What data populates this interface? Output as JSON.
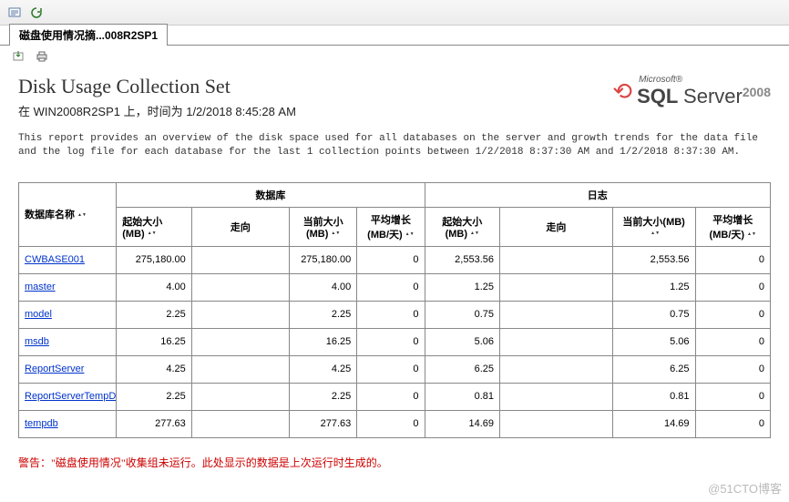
{
  "tab_label": "磁盘使用情况摘...008R2SP1",
  "report": {
    "title": "Disk Usage Collection Set",
    "subtitle": "在 WIN2008R2SP1 上，时间为 1/2/2018 8:45:28 AM",
    "description": "This report provides an overview of the disk space used for all databases on the server and growth trends for the data file and the log file for each database for the last 1 collection points between 1/2/2018 8:37:30 AM and 1/2/2018 8:37:30 AM.",
    "warning": "警告：\"磁盘使用情况\"收集组未运行。此处显示的数据是上次运行时生成的。"
  },
  "logo": {
    "ms": "Microsoft®",
    "sql": "SQL",
    "server": "Server",
    "year": "2008"
  },
  "columns": {
    "group_db": "数据库",
    "group_log": "日志",
    "name": "数据库名称",
    "start_size": "起始大小 (MB)",
    "trend": "走向",
    "current_size": "当前大小(MB)",
    "avg_growth": "平均增长 (MB/天)",
    "start_size2": "起始大小 (MB)",
    "trend2": "走向",
    "current_size2": "当前大小(MB)",
    "avg_growth2": "平均增长 (MB/天)"
  },
  "rows": [
    {
      "name": "CWBASE001",
      "d_start": "275,180.00",
      "d_cur": "275,180.00",
      "d_avg": "0",
      "l_start": "2,553.56",
      "l_cur": "2,553.56",
      "l_avg": "0"
    },
    {
      "name": "master",
      "d_start": "4.00",
      "d_cur": "4.00",
      "d_avg": "0",
      "l_start": "1.25",
      "l_cur": "1.25",
      "l_avg": "0"
    },
    {
      "name": "model",
      "d_start": "2.25",
      "d_cur": "2.25",
      "d_avg": "0",
      "l_start": "0.75",
      "l_cur": "0.75",
      "l_avg": "0"
    },
    {
      "name": "msdb",
      "d_start": "16.25",
      "d_cur": "16.25",
      "d_avg": "0",
      "l_start": "5.06",
      "l_cur": "5.06",
      "l_avg": "0"
    },
    {
      "name": "ReportServer",
      "d_start": "4.25",
      "d_cur": "4.25",
      "d_avg": "0",
      "l_start": "6.25",
      "l_cur": "6.25",
      "l_avg": "0"
    },
    {
      "name": "ReportServerTempDB",
      "d_start": "2.25",
      "d_cur": "2.25",
      "d_avg": "0",
      "l_start": "0.81",
      "l_cur": "0.81",
      "l_avg": "0"
    },
    {
      "name": "tempdb",
      "d_start": "277.63",
      "d_cur": "277.63",
      "d_avg": "0",
      "l_start": "14.69",
      "l_cur": "14.69",
      "l_avg": "0"
    }
  ],
  "watermark": "@51CTO博客"
}
